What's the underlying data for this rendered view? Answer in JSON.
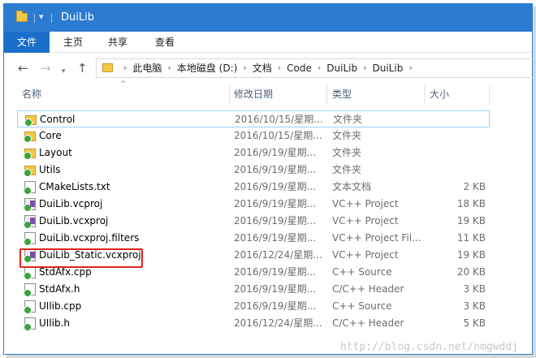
{
  "window": {
    "title": "DuiLib"
  },
  "ribbon": {
    "tabs": [
      "文件",
      "主页",
      "共享",
      "查看"
    ]
  },
  "breadcrumbs": [
    "此电脑",
    "本地磁盘 (D:)",
    "文档",
    "Code",
    "DuiLib",
    "DuiLib"
  ],
  "columns": {
    "name": "名称",
    "date": "修改日期",
    "type": "类型",
    "size": "大小"
  },
  "files": [
    {
      "name": "Control",
      "date": "2016/10/15/星期...",
      "type": "文件夹",
      "size": "",
      "icon": "folder-icon"
    },
    {
      "name": "Core",
      "date": "2016/10/15/星期...",
      "type": "文件夹",
      "size": "",
      "icon": "folder-icon"
    },
    {
      "name": "Layout",
      "date": "2016/9/19/星期...",
      "type": "文件夹",
      "size": "",
      "icon": "folder-icon"
    },
    {
      "name": "Utils",
      "date": "2016/9/19/星期...",
      "type": "文件夹",
      "size": "",
      "icon": "folder-icon"
    },
    {
      "name": "CMakeLists.txt",
      "date": "2016/9/19/星期...",
      "type": "文本文档",
      "size": "2 KB",
      "icon": "text-file-icon"
    },
    {
      "name": "DuiLib.vcproj",
      "date": "2016/9/19/星期...",
      "type": "VC++ Project",
      "size": "18 KB",
      "icon": "vs-project-icon"
    },
    {
      "name": "DuiLib.vcxproj",
      "date": "2016/9/19/星期...",
      "type": "VC++ Project",
      "size": "19 KB",
      "icon": "vs-project-icon"
    },
    {
      "name": "DuiLib.vcxproj.filters",
      "date": "2016/9/19/星期...",
      "type": "VC++ Project Fil...",
      "size": "11 KB",
      "icon": "vs-filters-icon"
    },
    {
      "name": "DuiLib_Static.vcxproj",
      "date": "2016/12/24/星期...",
      "type": "VC++ Project",
      "size": "19 KB",
      "icon": "vs-project-icon"
    },
    {
      "name": "StdAfx.cpp",
      "date": "2016/9/19/星期...",
      "type": "C++ Source",
      "size": "20 KB",
      "icon": "cpp-file-icon"
    },
    {
      "name": "StdAfx.h",
      "date": "2016/9/19/星期...",
      "type": "C/C++ Header",
      "size": "3 KB",
      "icon": "header-file-icon"
    },
    {
      "name": "UIlib.cpp",
      "date": "2016/9/19/星期...",
      "type": "C++ Source",
      "size": "3 KB",
      "icon": "cpp-file-icon"
    },
    {
      "name": "UIlib.h",
      "date": "2016/12/24/星期...",
      "type": "C/C++ Header",
      "size": "5 KB",
      "icon": "header-file-icon"
    }
  ],
  "watermark": "http://blog.csdn.net/nmgwddj",
  "colors": {
    "titlebar": "#2b7bd1",
    "highlight": "#e02020",
    "selection": "#99d1ff"
  }
}
